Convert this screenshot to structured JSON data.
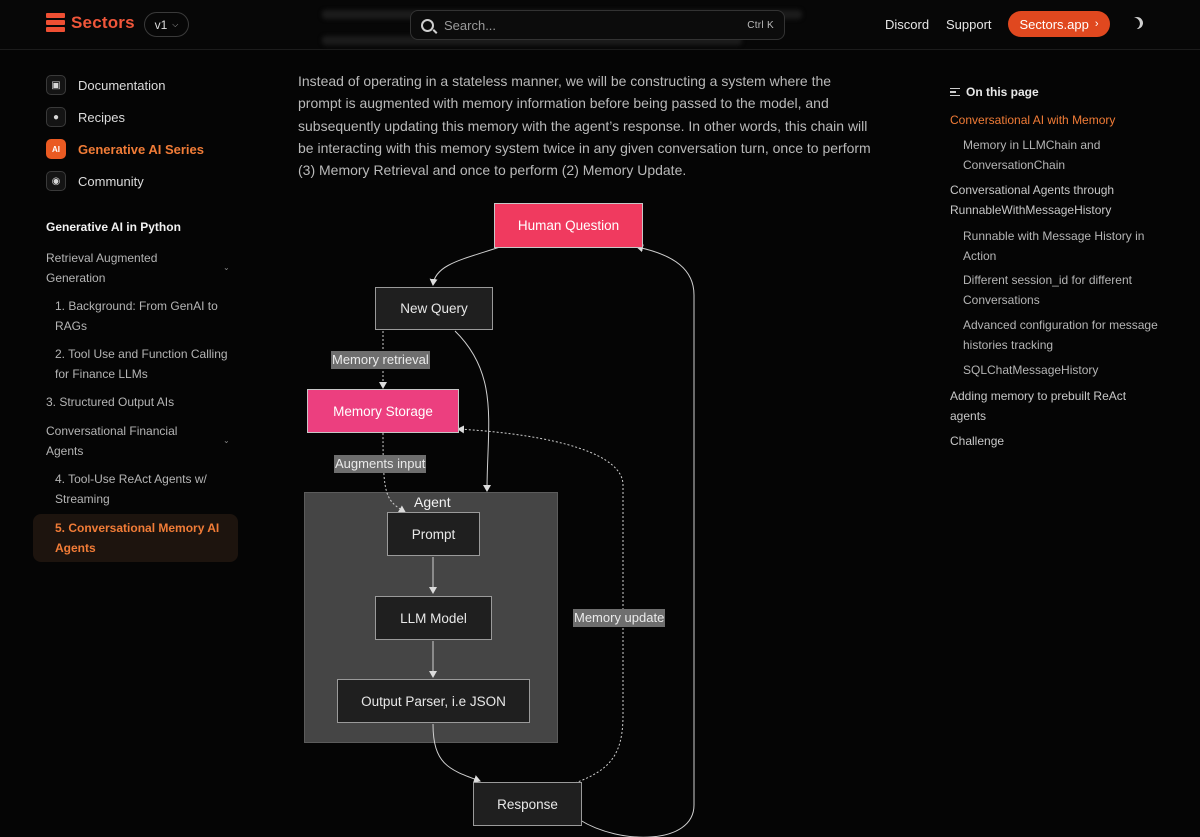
{
  "header": {
    "logo_text": "Sectors",
    "version": "v1",
    "search_placeholder": "Search...",
    "search_shortcut": "Ctrl K",
    "links": [
      "Discord",
      "Support"
    ],
    "cta_label": "Sectors.app",
    "cta_color": "#e0481f"
  },
  "sidebar": {
    "top_items": [
      {
        "label": "Documentation",
        "icon": "book-icon"
      },
      {
        "label": "Recipes",
        "icon": "lightbulb-icon"
      },
      {
        "label": "Generative AI Series",
        "icon": "ai-icon",
        "icon_text": "AI",
        "active": true
      },
      {
        "label": "Community",
        "icon": "discord-icon"
      }
    ],
    "section_title": "Generative AI in Python",
    "nav": [
      {
        "label": "Retrieval Augmented Generation"
      },
      {
        "label": "1. Background: From GenAI to RAGs"
      },
      {
        "label": "2. Tool Use and Function Calling for Finance LLMs"
      },
      {
        "label": "3. Structured Output AIs"
      },
      {
        "label": "Conversational Financial Agents"
      },
      {
        "label": "4. Tool-Use ReAct Agents w/ Streaming"
      },
      {
        "label": "5. Conversational Memory AI Agents",
        "active": true
      }
    ]
  },
  "main": {
    "paragraph": "Instead of operating in a stateless manner, we will be constructing a system where the prompt is augmented with memory information before being passed to the model, and subsequently updating this memory with the agent’s response. In other words, this chain will be interacting with this memory system twice in any given conversation turn, once to perform (3) Memory Retrieval and once to perform (2) Memory Update."
  },
  "diagram": {
    "nodes": {
      "human_question": "Human Question",
      "new_query": "New Query",
      "memory_storage": "Memory Storage",
      "agent": "Agent",
      "prompt": "Prompt",
      "llm_model": "LLM Model",
      "output_parser": "Output Parser, i.e JSON",
      "response": "Response"
    },
    "edge_labels": {
      "memory_retrieval": "Memory retrieval",
      "augments_input": "Augments input",
      "memory_update": "Memory update"
    },
    "colors": {
      "human_question": "#f03a5f",
      "memory_storage": "#ec3f7f",
      "agent_group": "#454545"
    }
  },
  "toc": {
    "title": "On this page",
    "items": [
      {
        "label": "Conversational AI with Memory",
        "level": 1,
        "active": true
      },
      {
        "label": "Memory in LLMChain and ConversationChain",
        "level": 2
      },
      {
        "label": "Conversational Agents through RunnableWithMessageHistory",
        "level": 1
      },
      {
        "label": "Runnable with Message History in Action",
        "level": 2
      },
      {
        "label": "Different session_id for different Conversations",
        "level": 2
      },
      {
        "label": "Advanced configuration for message histories tracking",
        "level": 2
      },
      {
        "label": "SQLChatMessageHistory",
        "level": 2
      },
      {
        "label": "Adding memory to prebuilt ReAct agents",
        "level": 1
      },
      {
        "label": "Challenge",
        "level": 1
      }
    ]
  },
  "accent_color": "#f17c37"
}
